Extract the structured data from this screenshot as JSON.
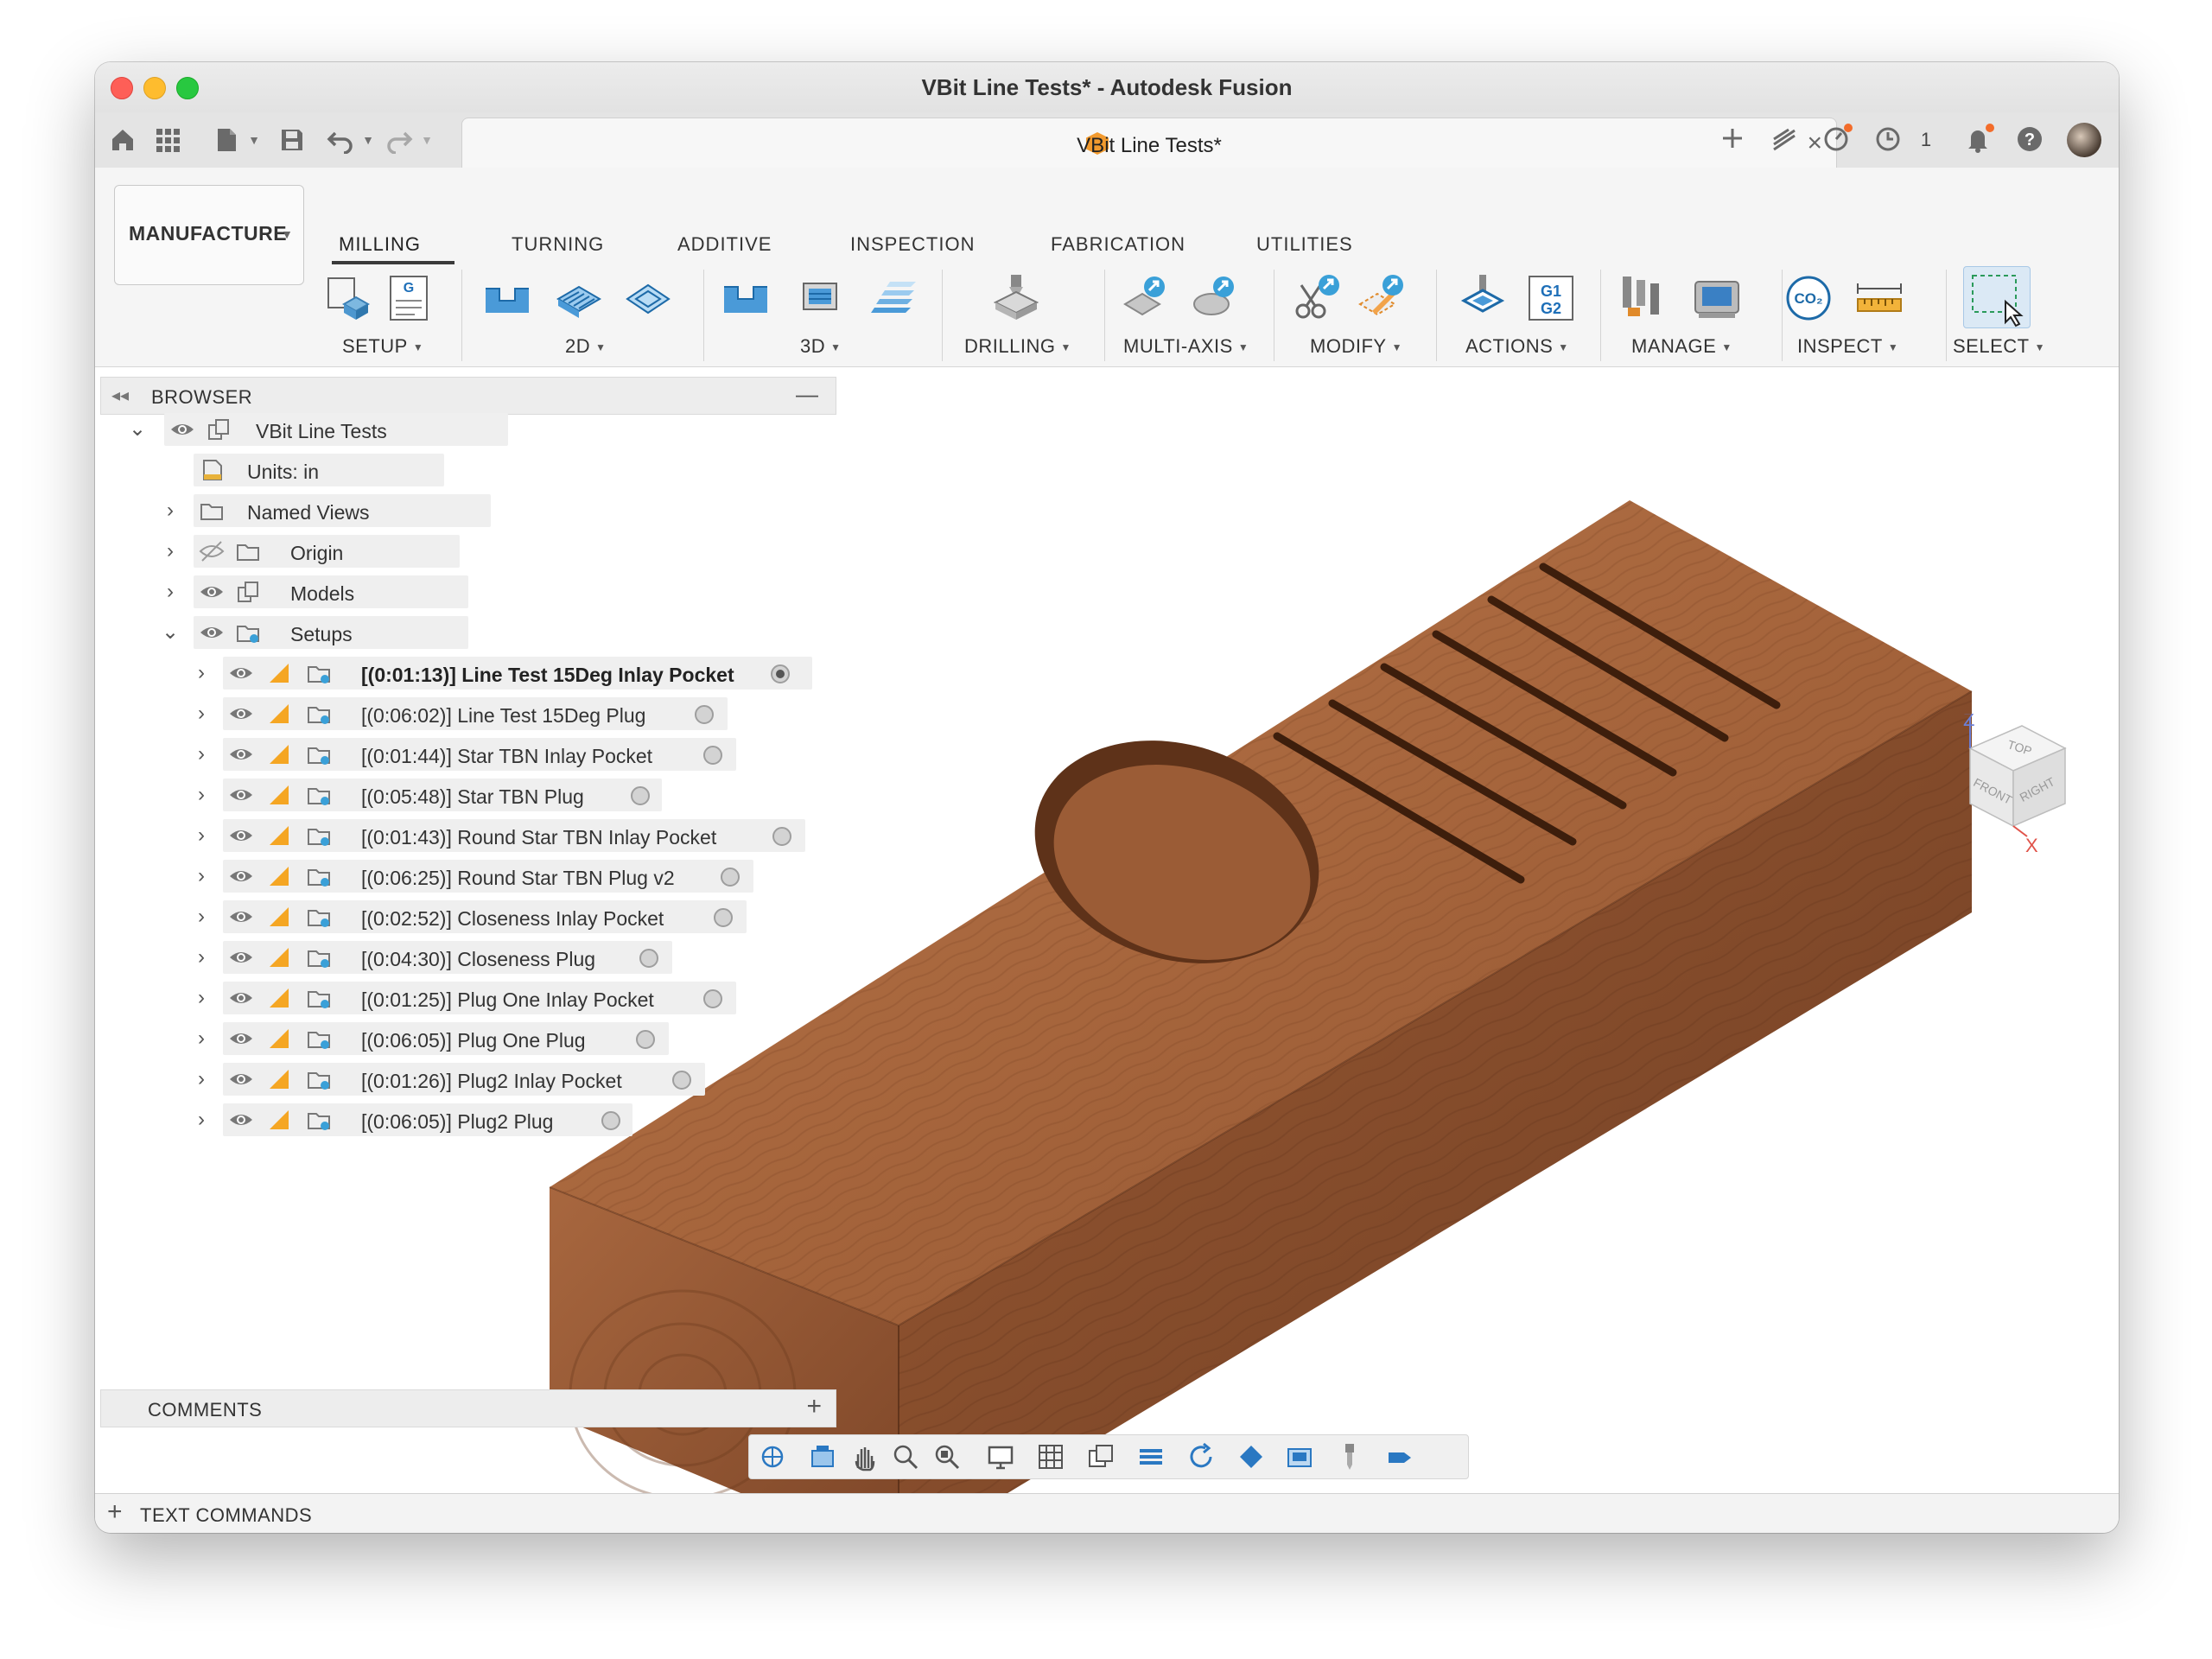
{
  "window": {
    "title": "VBit Line Tests* - Autodesk Fusion"
  },
  "tabbar": {
    "doc_tab_label": "VBit Line Tests*",
    "close_glyph": "×",
    "left_icons": [
      "home-icon",
      "grid-icon",
      "file-icon",
      "save-icon",
      "undo-icon",
      "redo-icon"
    ],
    "right_icons": [
      "new-tab-icon",
      "extensions-icon",
      "job-status-icon",
      "clock-icon",
      "notifications-icon",
      "help-icon",
      "avatar"
    ],
    "clock_count": "1"
  },
  "ribbon": {
    "workspace_label": "MANUFACTURE",
    "tabs": [
      "MILLING",
      "TURNING",
      "ADDITIVE",
      "INSPECTION",
      "FABRICATION",
      "UTILITIES"
    ],
    "active_tab": "MILLING",
    "groups": [
      "SETUP",
      "2D",
      "3D",
      "DRILLING",
      "MULTI-AXIS",
      "MODIFY",
      "ACTIONS",
      "MANAGE",
      "INSPECT",
      "SELECT"
    ]
  },
  "browser": {
    "title": "BROWSER",
    "root": "VBit Line Tests",
    "items": [
      {
        "label": "Units: in"
      },
      {
        "label": "Named Views"
      },
      {
        "label": "Origin"
      },
      {
        "label": "Models"
      },
      {
        "label": "Setups"
      }
    ],
    "setups": [
      {
        "label": "[(0:01:13)] Line Test 15Deg Inlay Pocket",
        "active": true
      },
      {
        "label": "[(0:06:02)] Line Test 15Deg Plug",
        "active": false
      },
      {
        "label": "[(0:01:44)] Star TBN Inlay Pocket",
        "active": false
      },
      {
        "label": "[(0:05:48)] Star TBN Plug",
        "active": false
      },
      {
        "label": "[(0:01:43)] Round Star TBN Inlay Pocket",
        "active": false
      },
      {
        "label": "[(0:06:25)] Round Star TBN Plug v2",
        "active": false
      },
      {
        "label": "[(0:02:52)] Closeness Inlay Pocket",
        "active": false
      },
      {
        "label": "[(0:04:30)] Closeness Plug",
        "active": false
      },
      {
        "label": "[(0:01:25)] Plug One Inlay Pocket",
        "active": false
      },
      {
        "label": "[(0:06:05)] Plug One Plug",
        "active": false
      },
      {
        "label": "[(0:01:26)] Plug2 Inlay Pocket",
        "active": false
      },
      {
        "label": "[(0:06:05)] Plug2 Plug",
        "active": false
      }
    ]
  },
  "viewcube": {
    "top": "TOP",
    "front": "FRONT",
    "right": "RIGHT",
    "axis_z": "Z",
    "axis_x": "X"
  },
  "comments": {
    "title": "COMMENTS",
    "add_glyph": "+"
  },
  "textcommands": {
    "label": "TEXT COMMANDS",
    "expand_glyph": "+"
  },
  "colors": {
    "accent_orange": "#f29a2e",
    "wood_top": "#a8673f",
    "wood_side": "#8a4f2c",
    "wood_end": "#9b5c36",
    "select_blue": "#3aa0d8"
  }
}
